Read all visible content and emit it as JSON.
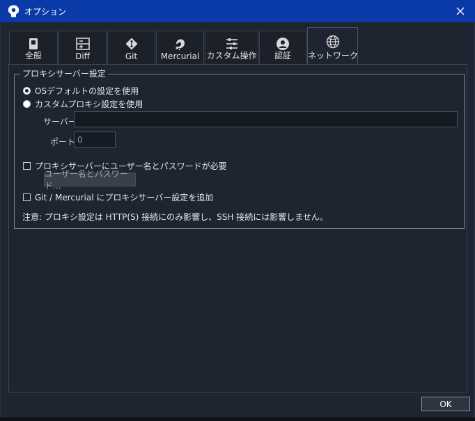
{
  "window": {
    "title": "オプション"
  },
  "tabs": [
    {
      "label": "全般",
      "icon": "toggle-icon"
    },
    {
      "label": "Diff",
      "icon": "diff-icon"
    },
    {
      "label": "Git",
      "icon": "git-icon"
    },
    {
      "label": "Mercurial",
      "icon": "mercurial-icon"
    },
    {
      "label": "カスタム操作",
      "icon": "custom-actions-icon"
    },
    {
      "label": "認証",
      "icon": "user-icon"
    },
    {
      "label": "ネットワーク",
      "icon": "globe-icon",
      "active": true
    }
  ],
  "proxy": {
    "group_title": "プロキシサーバー設定",
    "radio_os_default": "OSデフォルトの設定を使用",
    "radio_custom": "カスタムプロキシ設定を使用",
    "server_label": "サーバー:",
    "server_value": "",
    "port_label": "ポート:",
    "port_value": "0",
    "require_auth_label": "プロキシサーバーにユーザー名とパスワードが必要",
    "user_pass_button": "ユーザー名とパスワード...",
    "add_to_git_label": "Git / Mercurial にプロキシサーバー設定を追加",
    "note": "注意: プロキシ設定は HTTP(S) 接続にのみ影響し、SSH 接続には影響しません。",
    "selected": "os_default"
  },
  "footer": {
    "ok_label": "OK"
  },
  "colors": {
    "titlebar": "#0a3aa8",
    "background": "#1e2530",
    "border": "#7d8594"
  }
}
